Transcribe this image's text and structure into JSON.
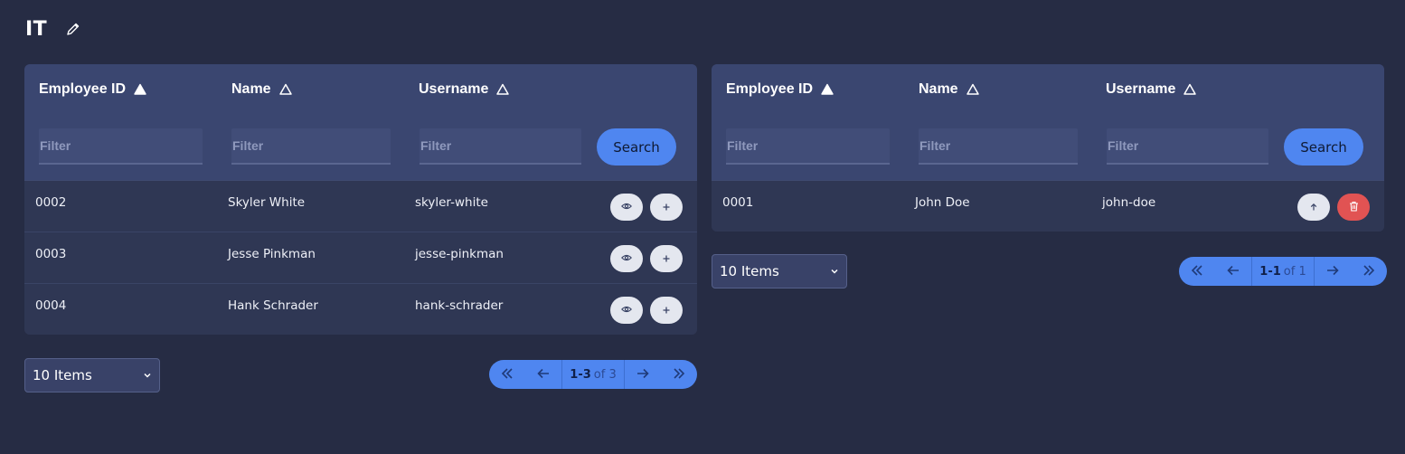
{
  "page": {
    "title": "IT"
  },
  "left_table": {
    "columns": [
      "Employee ID",
      "Name",
      "Username"
    ],
    "filter_placeholder": "Filter",
    "search_label": "Search",
    "rows": [
      {
        "id": "0002",
        "name": "Skyler White",
        "username": "skyler-white"
      },
      {
        "id": "0003",
        "name": "Jesse Pinkman",
        "username": "jesse-pinkman"
      },
      {
        "id": "0004",
        "name": "Hank Schrader",
        "username": "hank-schrader"
      }
    ],
    "page_size": "10 Items",
    "pager": {
      "range": "1-3",
      "of": "of 3"
    }
  },
  "right_table": {
    "columns": [
      "Employee ID",
      "Name",
      "Username"
    ],
    "filter_placeholder": "Filter",
    "search_label": "Search",
    "rows": [
      {
        "id": "0001",
        "name": "John Doe",
        "username": "john-doe"
      }
    ],
    "page_size": "10 Items",
    "pager": {
      "range": "1-1",
      "of": "of 1"
    }
  },
  "colors": {
    "background": "#262c44",
    "header": "#3a4670",
    "row": "#2f3754",
    "accent": "#4f86f0",
    "danger": "#e15353"
  },
  "icons": {
    "edit": "pencil-icon",
    "sort_active": "triangle-filled-icon",
    "sort_inactive": "triangle-outline-icon",
    "view": "eye-icon",
    "add": "plus-icon",
    "move_up": "arrow-up-icon",
    "delete": "trash-icon",
    "first": "chevrons-left-icon",
    "prev": "arrow-left-icon",
    "next": "arrow-right-icon",
    "last": "chevrons-right-icon",
    "dropdown": "chevron-down-icon"
  }
}
